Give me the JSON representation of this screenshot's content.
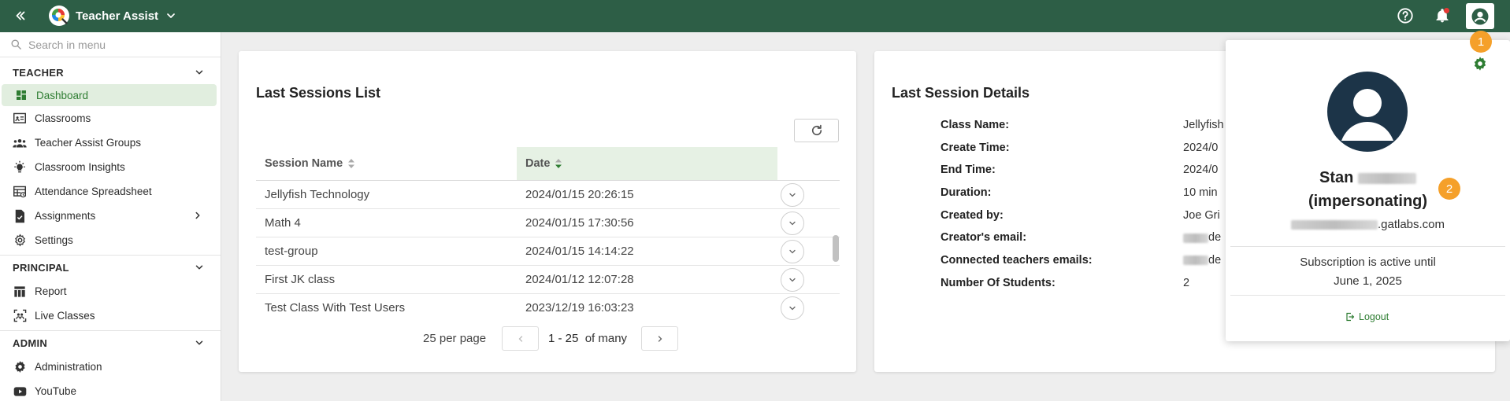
{
  "topbar": {
    "app_title": "Teacher Assist",
    "colors": {
      "background": "#2d5e46",
      "accent": "#2e7d32"
    }
  },
  "sidebar": {
    "search_placeholder": "Search in menu",
    "sections": [
      {
        "title": "TEACHER",
        "items": [
          {
            "label": "Dashboard",
            "icon": "dashboard-icon",
            "active": true
          },
          {
            "label": "Classrooms",
            "icon": "classroom-icon"
          },
          {
            "label": "Teacher Assist Groups",
            "icon": "groups-icon"
          },
          {
            "label": "Classroom Insights",
            "icon": "lightbulb-icon"
          },
          {
            "label": "Attendance Spreadsheet",
            "icon": "spreadsheet-icon"
          },
          {
            "label": "Assignments",
            "icon": "assignment-icon"
          },
          {
            "label": "Settings",
            "icon": "gear-icon"
          }
        ]
      },
      {
        "title": "PRINCIPAL",
        "items": [
          {
            "label": "Report",
            "icon": "report-icon"
          },
          {
            "label": "Live Classes",
            "icon": "live-classes-icon"
          }
        ]
      },
      {
        "title": "ADMIN",
        "items": [
          {
            "label": "Administration",
            "icon": "gear-icon"
          },
          {
            "label": "YouTube",
            "icon": "youtube-icon"
          }
        ]
      }
    ]
  },
  "sessions_card": {
    "title": "Last Sessions List",
    "columns": {
      "name": "Session Name",
      "date": "Date"
    },
    "rows": [
      {
        "name": "Jellyfish Technology",
        "date": "2024/01/15 20:26:15"
      },
      {
        "name": "Math 4",
        "date": "2024/01/15 17:30:56"
      },
      {
        "name": "test-group",
        "date": "2024/01/15 14:14:22"
      },
      {
        "name": "First JK class",
        "date": "2024/01/12 12:07:28"
      },
      {
        "name": "Test Class With Test Users",
        "date": "2023/12/19 16:03:23"
      }
    ],
    "pager": {
      "per_page": "25 per page",
      "range": "1 - 25",
      "of_many": "of many"
    }
  },
  "details_card": {
    "title": "Last Session Details",
    "rows": [
      {
        "label": "Class Name:",
        "value": "Jellyfish"
      },
      {
        "label": "Create Time:",
        "value": "2024/0"
      },
      {
        "label": "End Time:",
        "value": "2024/0"
      },
      {
        "label": "Duration:",
        "value": "10 min"
      },
      {
        "label": "Created by:",
        "value": "Joe Gri"
      },
      {
        "label": "Creator's email:",
        "value": "de"
      },
      {
        "label": "Connected teachers emails:",
        "value": "de"
      },
      {
        "label": "Number Of Students:",
        "value": "2"
      }
    ]
  },
  "profile": {
    "first_name": "Stan",
    "status": "(impersonating)",
    "email_domain": ".gatlabs.com",
    "subscription_line1": "Subscription is active until",
    "subscription_line2": "June 1, 2025",
    "logout_label": "Logout"
  },
  "badges": {
    "one": "1",
    "two": "2"
  }
}
